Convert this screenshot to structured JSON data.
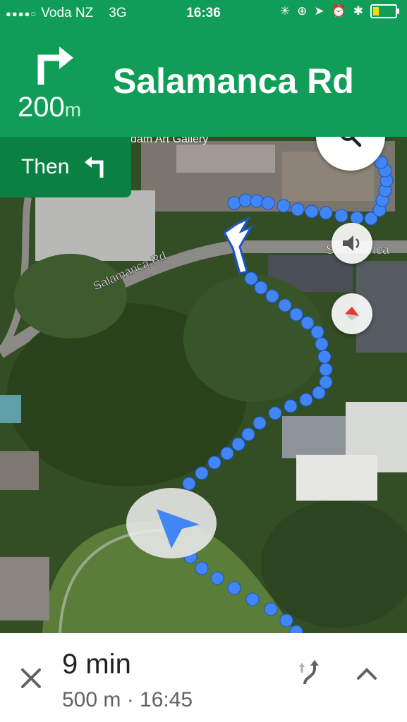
{
  "status_bar": {
    "carrier": "Voda NZ",
    "network": "3G",
    "time": "16:36",
    "battery_level": 0.25
  },
  "navigation": {
    "distance_value": "200",
    "distance_unit": "m",
    "street": "Salamanca Rd",
    "maneuver_icon": "turn-right-icon",
    "then_label": "Then",
    "then_icon": "turn-left-icon"
  },
  "map": {
    "road_label": "Salamanca Rd",
    "road_label_right": "Salamanca",
    "poi_label": "dam Art Gallery",
    "route_color": "#4285f4"
  },
  "trip": {
    "duration": "9 min",
    "details": "500 m · 16:45"
  },
  "colors": {
    "header": "#0f9d58",
    "then_box": "#0b8043",
    "accent": "#4285f4"
  }
}
